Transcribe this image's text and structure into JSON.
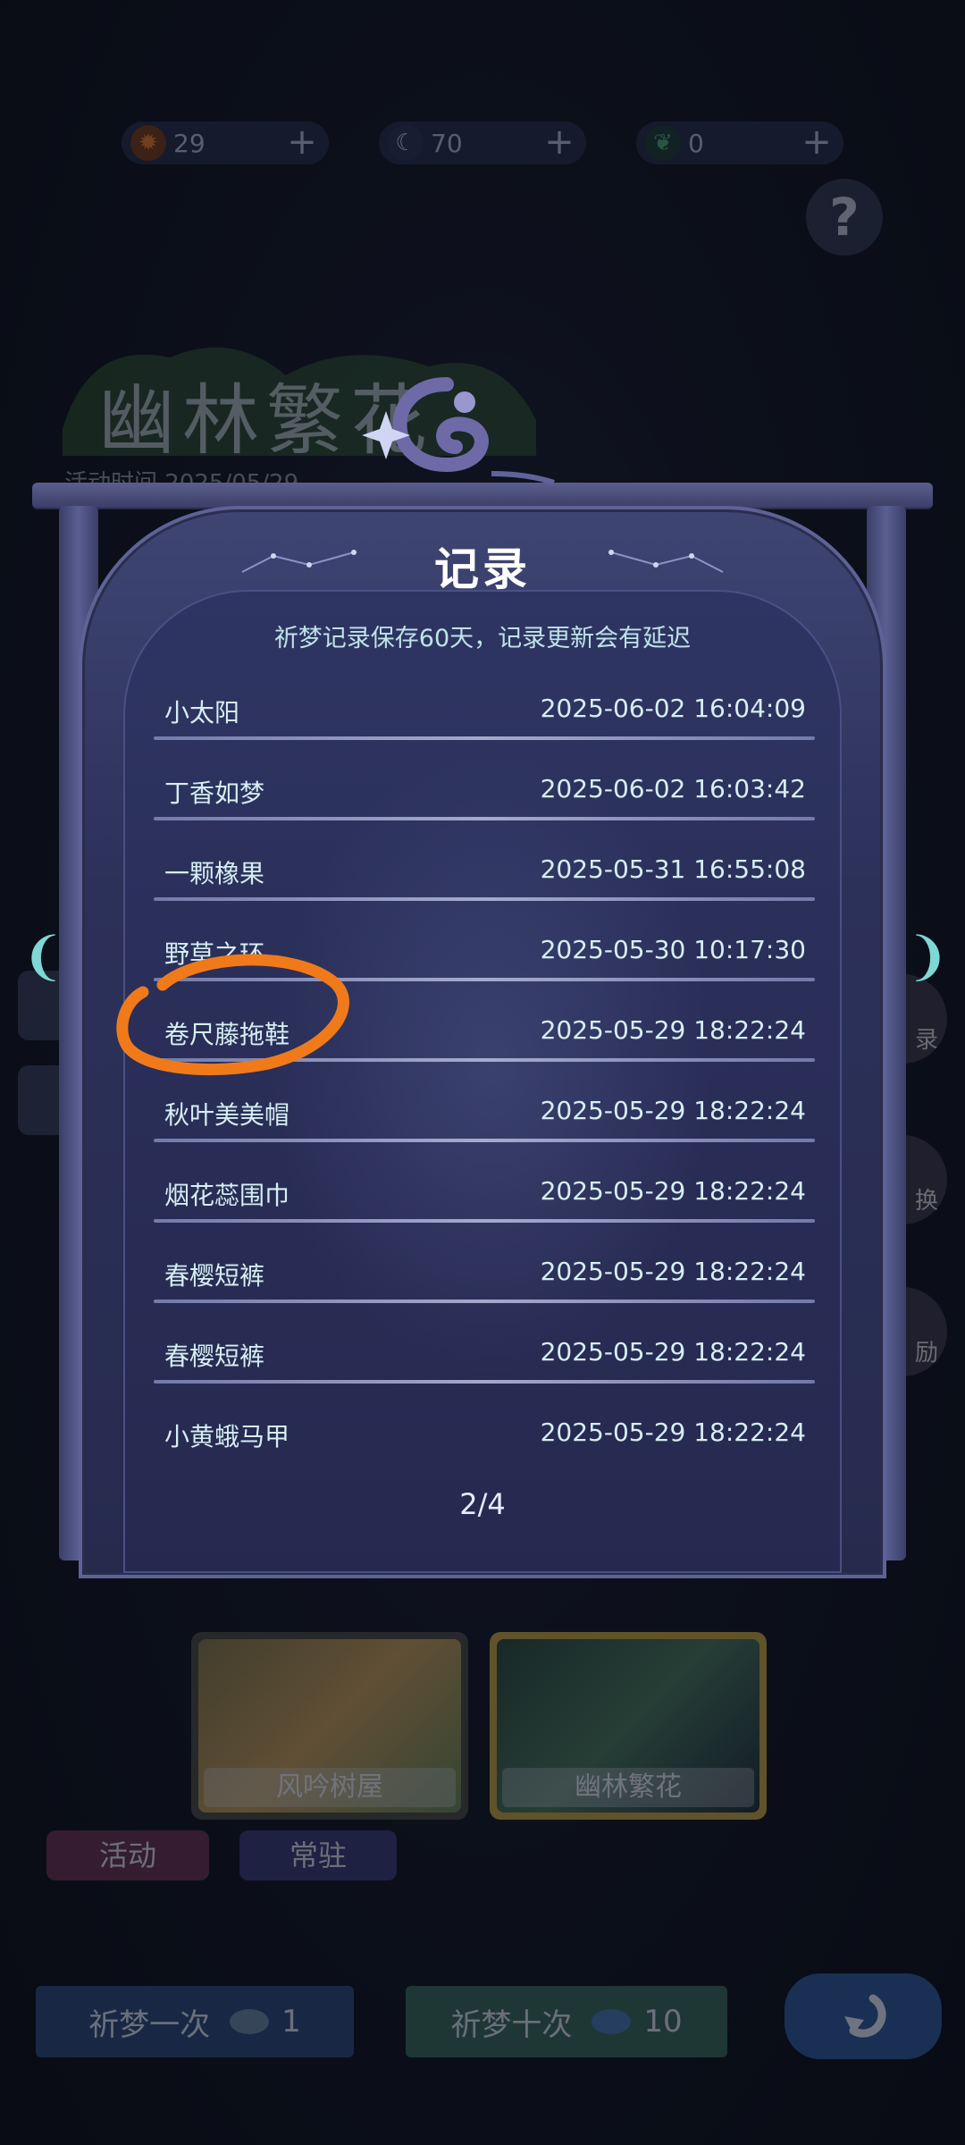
{
  "currencies": [
    {
      "name": "sun-coin",
      "value": "29",
      "color": "#f07a2a"
    },
    {
      "name": "moon",
      "value": "70",
      "color": "#cfd6f0"
    },
    {
      "name": "leaf-gem",
      "value": "0",
      "color": "#4caf78"
    }
  ],
  "event": {
    "title": "幽林繁花",
    "time": "活动时间 2025/05/29"
  },
  "right_icons": [
    "录",
    "换",
    "励"
  ],
  "dialog": {
    "title": "记录",
    "subtitle": "祈梦记录保存60天，记录更新会有延迟",
    "records": [
      {
        "name": "小太阳",
        "time": "2025-06-02 16:04:09"
      },
      {
        "name": "丁香如梦",
        "time": "2025-06-02 16:03:42"
      },
      {
        "name": "一颗橡果",
        "time": "2025-05-31 16:55:08"
      },
      {
        "name": "野草之环",
        "time": "2025-05-30 10:17:30"
      },
      {
        "name": "卷尺藤拖鞋",
        "time": "2025-05-29 18:22:24"
      },
      {
        "name": "秋叶美美帽",
        "time": "2025-05-29 18:22:24"
      },
      {
        "name": "烟花蕊围巾",
        "time": "2025-05-29 18:22:24"
      },
      {
        "name": "春樱短裤",
        "time": "2025-05-29 18:22:24"
      },
      {
        "name": "春樱短裤",
        "time": "2025-05-29 18:22:24"
      },
      {
        "name": "小黄蛾马甲",
        "time": "2025-05-29 18:22:24"
      }
    ],
    "page": "2/4"
  },
  "pools": [
    {
      "label": "风吟树屋"
    },
    {
      "label": "幽林繁花"
    }
  ],
  "pool_tabs": [
    "活动",
    "常驻"
  ],
  "bottom": {
    "pray_once_label": "祈梦一次",
    "pray_once_count": "1",
    "pray_ten_label": "祈梦十次",
    "pray_ten_count": "10"
  },
  "colors": {
    "annotation": "#f07a1a",
    "accent_teal": "#7fd7d6"
  }
}
